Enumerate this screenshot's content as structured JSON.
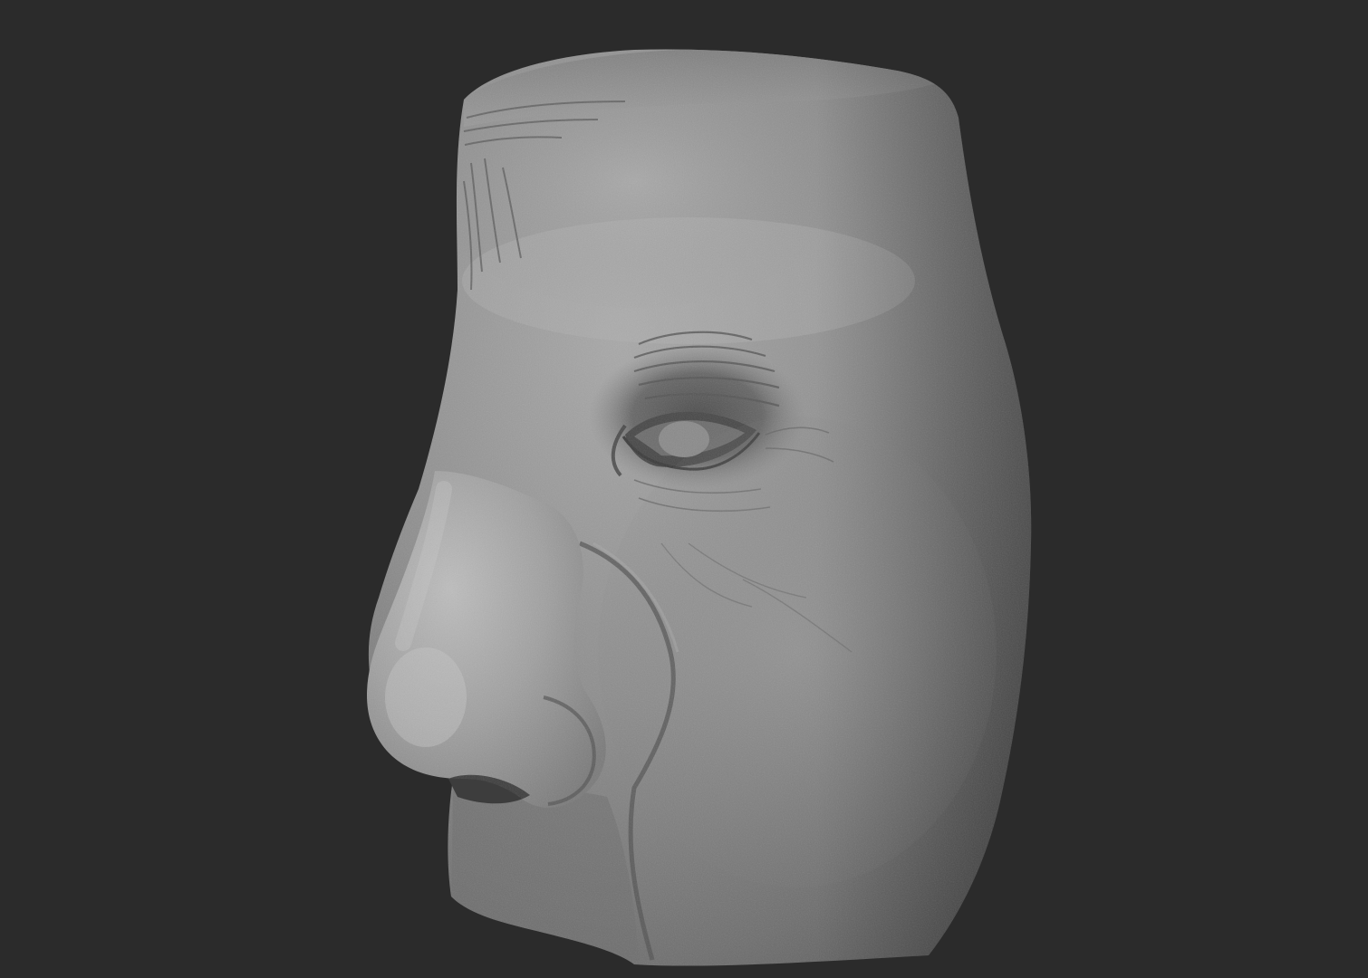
{
  "scene": {
    "subject": "face-sculpt",
    "background_color": "#2b2b2b",
    "material_color": "#8a8a8a",
    "highlight_color": "#b2b2b2",
    "shadow_color": "#4a4a4a"
  }
}
